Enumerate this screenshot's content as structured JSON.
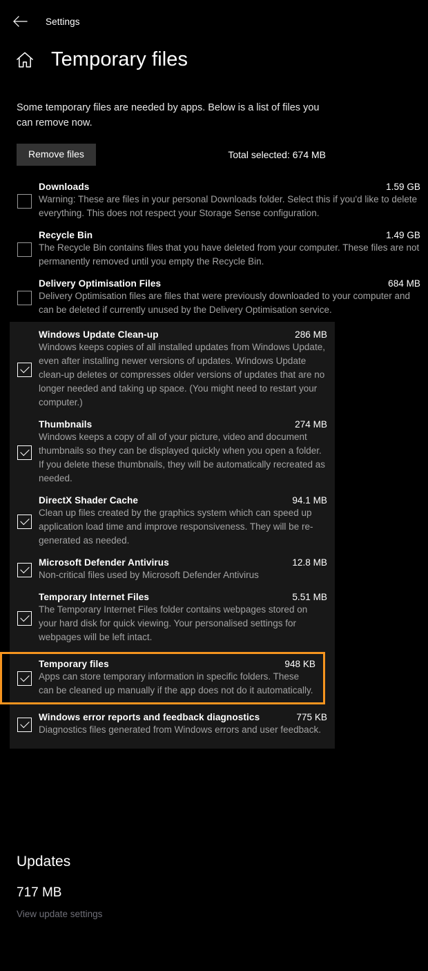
{
  "titlebar": {
    "back_icon": "back-arrow-icon",
    "label": "Settings"
  },
  "header": {
    "home_icon": "home-icon",
    "title": "Temporary files"
  },
  "intro": "Some temporary files are needed by apps. Below is a list of files you can remove now.",
  "actions": {
    "remove_label": "Remove files",
    "total_selected": "Total selected: 674 MB"
  },
  "colors": {
    "background": "#000000",
    "panel": "#181818",
    "highlight_border": "#f5941f",
    "button": "#333333",
    "description_text": "#a3a3a3",
    "link_text": "#6f6f78"
  },
  "list": {
    "unchecked_items": [
      {
        "title": "Downloads",
        "size": "1.59 GB",
        "description": "Warning: These are files in your personal Downloads folder. Select this if you'd like to delete everything. This does not respect your Storage Sense configuration.",
        "checked": false
      },
      {
        "title": "Recycle Bin",
        "size": "1.49 GB",
        "description": "The Recycle Bin contains files that you have deleted from your computer. These files are not permanently removed until you empty the Recycle Bin.",
        "checked": false
      },
      {
        "title": "Delivery Optimisation Files",
        "size": "684 MB",
        "description": "Delivery Optimisation files are files that were previously downloaded to your computer and can be deleted if currently unused by the Delivery Optimisation service.",
        "checked": false
      }
    ],
    "checked_items": [
      {
        "title": "Windows Update Clean-up",
        "size": "286 MB",
        "description": "Windows keeps copies of all installed updates from Windows Update, even after installing newer versions of updates. Windows Update clean-up deletes or compresses older versions of updates that are no longer needed and taking up space. (You might need to restart your computer.)",
        "checked": true,
        "highlighted": false
      },
      {
        "title": "Thumbnails",
        "size": "274 MB",
        "description": "Windows keeps a copy of all of your picture, video and document thumbnails so they can be displayed quickly when you open a folder. If you delete these thumbnails, they will be automatically recreated as needed.",
        "checked": true,
        "highlighted": false
      },
      {
        "title": "DirectX Shader Cache",
        "size": "94.1 MB",
        "description": "Clean up files created by the graphics system which can speed up application load time and improve responsiveness. They will be re-generated as needed.",
        "checked": true,
        "highlighted": false
      },
      {
        "title": "Microsoft Defender Antivirus",
        "size": "12.8 MB",
        "description": "Non-critical files used by Microsoft Defender Antivirus",
        "checked": true,
        "highlighted": false
      },
      {
        "title": "Temporary Internet Files",
        "size": "5.51 MB",
        "description": "The Temporary Internet Files folder contains webpages stored on your hard disk for quick viewing. Your personalised settings for webpages will be left intact.",
        "checked": true,
        "highlighted": false
      },
      {
        "title": "Temporary files",
        "size": "948 KB",
        "description": "Apps can store temporary information in specific folders. These can be cleaned up manually if the app does not do it automatically.",
        "checked": true,
        "highlighted": true
      },
      {
        "title": "Windows error reports and feedback diagnostics",
        "size": "775 KB",
        "description": "Diagnostics files generated from Windows errors and user feedback.",
        "checked": true,
        "highlighted": false
      }
    ]
  },
  "updates": {
    "title": "Updates",
    "size": "717 MB",
    "link": "View update settings"
  }
}
